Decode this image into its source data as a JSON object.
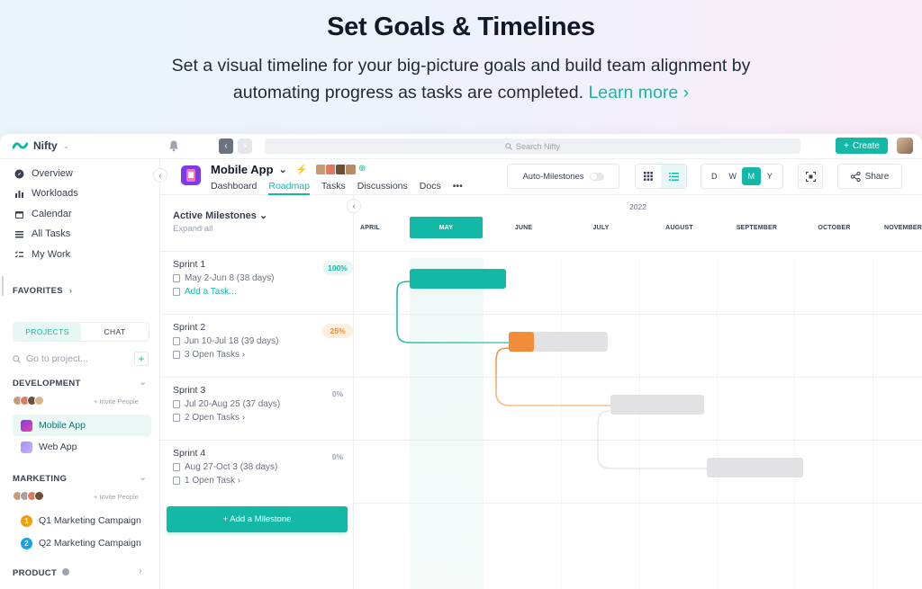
{
  "hero": {
    "title": "Set Goals & Timelines",
    "subtitle": "Set a visual timeline for your big-picture goals and build team alignment by automating progress as tasks are completed.",
    "link": "Learn more ›"
  },
  "topbar": {
    "brand": "Nifty",
    "search_placeholder": "Search Nifty",
    "create_label": "Create"
  },
  "sidebar": {
    "nav": [
      "Overview",
      "Workloads",
      "Calendar",
      "All Tasks",
      "My Work"
    ],
    "favorites": "FAVORITES",
    "tabs": [
      "PROJECTS",
      "CHAT"
    ],
    "goto_placeholder": "Go to project...",
    "sections": [
      {
        "label": "DEVELOPMENT",
        "invite": "+ Invite People",
        "projects": [
          {
            "name": "Mobile App"
          },
          {
            "name": "Web App"
          }
        ]
      },
      {
        "label": "MARKETING",
        "invite": "+ Invite People",
        "projects": [
          {
            "name": "Q1 Marketing Campaign",
            "badge": "1"
          },
          {
            "name": "Q2 Marketing Campaign",
            "badge": "2"
          }
        ]
      },
      {
        "label": "PRODUCT"
      }
    ]
  },
  "project": {
    "title": "Mobile App",
    "tabs": [
      "Dashboard",
      "Roadmap",
      "Tasks",
      "Discussions",
      "Docs",
      "•••"
    ],
    "active_tab": "Roadmap",
    "auto_milestones": "Auto-Milestones",
    "scale": [
      "D",
      "W",
      "M",
      "Y"
    ],
    "active_scale": "M",
    "share": "Share"
  },
  "milestones": {
    "header": "Active Milestones",
    "expand": "Expand all",
    "rows": [
      {
        "name": "Sprint 1",
        "dates": "May 2-Jun 8 (38 days)",
        "tasks": "Add a Task...",
        "pct": "100%"
      },
      {
        "name": "Sprint 2",
        "dates": "Jun 10-Jul 18 (39 days)",
        "tasks": "3 Open Tasks ›",
        "pct": "25%"
      },
      {
        "name": "Sprint 3",
        "dates": "Jul 20-Aug 25 (37 days)",
        "tasks": "2 Open Tasks ›",
        "pct": "0%"
      },
      {
        "name": "Sprint 4",
        "dates": "Aug 27-Oct 3 (38 days)",
        "tasks": "1 Open Task ›",
        "pct": "0%"
      }
    ],
    "add_button": "+ Add a Milestone"
  },
  "timeline": {
    "year": "2022",
    "months": [
      "APRIL",
      "MAY",
      "JUNE",
      "JULY",
      "AUGUST",
      "SEPTEMBER",
      "OCTOBER",
      "NOVEMBER"
    ],
    "active_month": "MAY"
  },
  "colors": {
    "accent": "#14b8a6",
    "orange": "#f28c38",
    "muted_bar": "#e2e2e4"
  }
}
